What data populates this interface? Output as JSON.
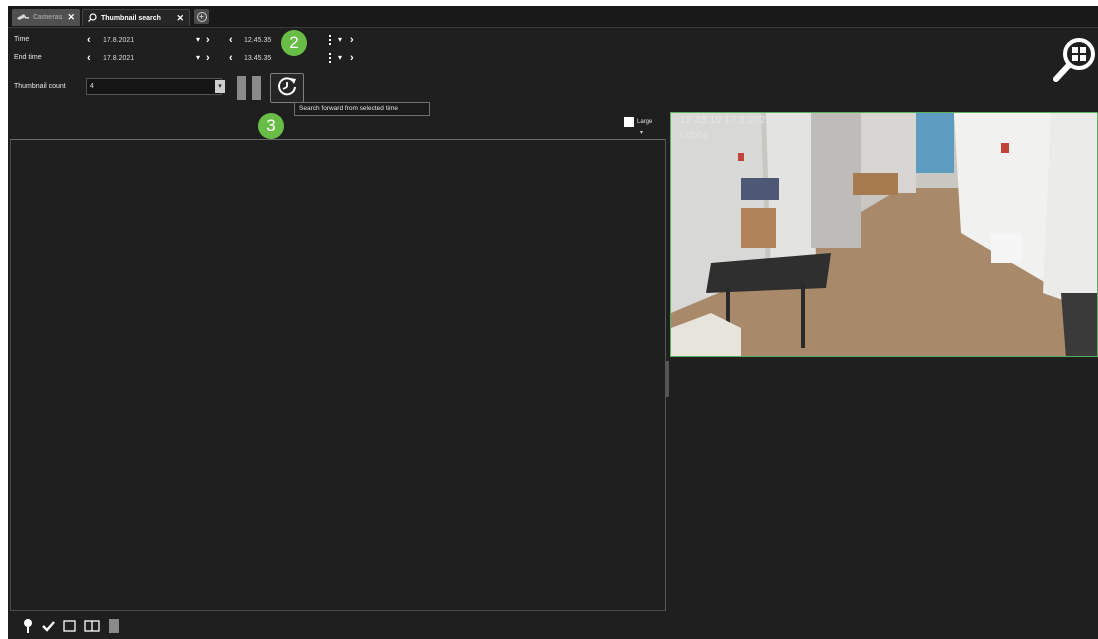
{
  "tabs": [
    {
      "label": "Cameras",
      "close": "✕"
    },
    {
      "label": "Thumbnail search",
      "close": "✕"
    }
  ],
  "controls": {
    "time_label": "Time",
    "time_date": "17.8.2021",
    "time_clock": "12.45.35",
    "end_time_label": "End time",
    "end_date": "17.8.2021",
    "end_clock": "13.45.35",
    "thumbnail_count_label": "Thumbnail count",
    "thumbnail_count_value": "4",
    "tooltip": "Search forward from selected time",
    "large_label": "Large"
  },
  "badges": {
    "step2": "2",
    "step3": "3"
  },
  "camera": {
    "timestamp": "12.43.10  17.8.2021",
    "name": "Lobby"
  },
  "colors": {
    "background": "#1f1f1f",
    "badge_green": "#68bd46",
    "camera_border": "#5bb05b"
  },
  "icons": [
    "cameras-icon",
    "search-icon",
    "add-tab-icon",
    "pause-icon",
    "search-forward-icon",
    "zoom-grid-icon",
    "pin-icon",
    "check-icon",
    "single-view-icon",
    "split-view-icon",
    "panel-icon"
  ]
}
